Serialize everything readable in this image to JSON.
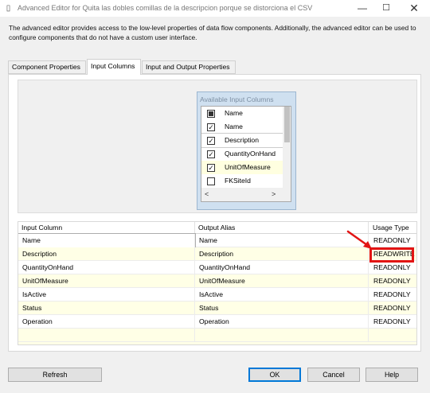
{
  "window": {
    "title": "Advanced Editor for Quita las dobles comillas de la descripcion porque se distorciona el CSV",
    "minimize_glyph": "—",
    "maximize_glyph": "☐",
    "close_glyph": "✕",
    "app_icon": "document-icon"
  },
  "description": "The advanced editor provides access to the low-level properties of data flow components. Additionally, the advanced editor can be used to configure components that do not have a custom user interface.",
  "tabs": [
    {
      "label": "Component Properties",
      "active": false
    },
    {
      "label": "Input Columns",
      "active": true
    },
    {
      "label": "Input and Output Properties",
      "active": false
    }
  ],
  "available": {
    "title": "Available Input Columns",
    "header_label": "Name",
    "items": [
      {
        "label": "Name",
        "checked": true
      },
      {
        "label": "Description",
        "checked": true
      },
      {
        "label": "QuantityOnHand",
        "checked": true
      },
      {
        "label": "UnitOfMeasure",
        "checked": true
      },
      {
        "label": "FKSiteId",
        "checked": false
      }
    ],
    "scroll_left": "<",
    "scroll_right": ">"
  },
  "grid": {
    "headers": [
      "Input Column",
      "Output Alias",
      "Usage Type"
    ],
    "rows": [
      [
        "Name",
        "Name",
        "READONLY"
      ],
      [
        "Description",
        "Description",
        "READWRITE"
      ],
      [
        "QuantityOnHand",
        "QuantityOnHand",
        "READONLY"
      ],
      [
        "UnitOfMeasure",
        "UnitOfMeasure",
        "READONLY"
      ],
      [
        "IsActive",
        "IsActive",
        "READONLY"
      ],
      [
        "Status",
        "Status",
        "READONLY"
      ],
      [
        "Operation",
        "Operation",
        "READONLY"
      ]
    ]
  },
  "buttons": {
    "refresh": "Refresh",
    "ok": "OK",
    "cancel": "Cancel",
    "help": "Help"
  },
  "colors": {
    "annotation_red": "#e21414",
    "selected_row_yellow": "#ffffe6"
  }
}
